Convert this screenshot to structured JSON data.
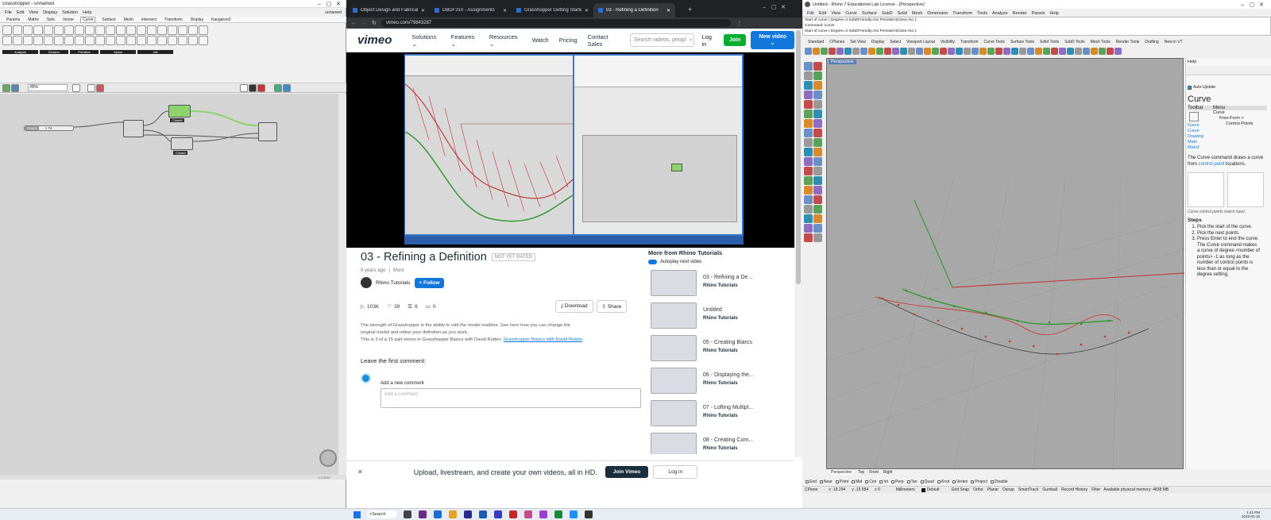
{
  "grasshopper": {
    "title": "Grasshopper - unnamed",
    "doc_name": "unnamed",
    "menu": [
      "File",
      "Edit",
      "View",
      "Display",
      "Solution",
      "Help"
    ],
    "tabs": [
      "Params",
      "Maths",
      "Sets",
      "Vector",
      "Curve",
      "Surface",
      "Mesh",
      "Intersect",
      "Transform",
      "Display",
      "Kangaroo2"
    ],
    "active_tab": "Curve",
    "groups": [
      "Analysis",
      "Division",
      "Primitive",
      "Spline",
      "Util"
    ],
    "zoom": "85%",
    "slider_label": "Count",
    "slider_value": "◊ 74",
    "node_labels": [
      "Closed",
      "Closed"
    ],
    "version": "1.0.0007"
  },
  "browser": {
    "tabs": [
      "Object Design and Fabrication",
      "DBDF310 - Assignments",
      "Grasshopper Getting Started by",
      "03 - Refining a Definition"
    ],
    "active_tab_index": 3,
    "url": "vimeo.com/79843287",
    "nav": {
      "logo": "vimeo",
      "items": [
        "Solutions ⌄",
        "Features ⌄",
        "Resources ⌄",
        "Watch",
        "Pricing",
        "Contact Sales"
      ],
      "search_placeholder": "Search videos, peopl",
      "login": "Log in",
      "join": "Join",
      "new_video": "New video ⌄"
    },
    "video": {
      "title": "03 - Refining a Definition",
      "rating": "NOT YET RATED",
      "posted": "9 years ago",
      "more": "More",
      "channel": "Rhino Tutorials",
      "follow": "+ Follow",
      "stats": {
        "plays": "103K",
        "likes": "39",
        "collections": "6",
        "comments": "0"
      },
      "download": "Download",
      "share": "Share",
      "description": [
        "The strength of Grasshopper is the ability to edit the model realtime. See here how you can change the",
        "original model and refine your definition as you work.",
        "This is 3 of a 15 part series in Grasshopper Basics with David Rutten."
      ],
      "desc_link": "Grasshopper Basics with David Rutten",
      "leave_comment": "Leave the first comment:",
      "add_comment_label": "Add a new comment",
      "comment_placeholder": "Add a comment"
    },
    "sidebar": {
      "heading": "More from Rhino Tutorials",
      "autoplay": "Autoplay next video",
      "items": [
        {
          "title": "03 - Refining a De...",
          "channel": "Rhino Tutorials"
        },
        {
          "title": "Untitled",
          "channel": "Rhino Tutorials"
        },
        {
          "title": "05 - Creating Biarcs",
          "channel": "Rhino Tutorials"
        },
        {
          "title": "06 - Displaying the...",
          "channel": "Rhino Tutorials"
        },
        {
          "title": "07 - Lofting Multipl...",
          "channel": "Rhino Tutorials"
        },
        {
          "title": "08 - Creating Com...",
          "channel": "Rhino Tutorials"
        }
      ]
    },
    "banner": {
      "text": "Upload, livestream, and create your own videos, all in HD.",
      "join": "Join Vimeo",
      "login": "Log in"
    }
  },
  "rhino": {
    "title": "Untitled - Rhino 7 Educational Lab License - [Perspective]",
    "menu": [
      "File",
      "Edit",
      "View",
      "Curve",
      "Surface",
      "SubD",
      "Solid",
      "Mesh",
      "Dimension",
      "Transform",
      "Tools",
      "Analyze",
      "Render",
      "Panels",
      "Help"
    ],
    "cmd_lines": [
      "Start of curve ( Degree=3  SubDFriendly=No  PersistentClose=No ):",
      "Command: Curve",
      "Start of curve ( Degree=3  SubDFriendly=No  PersistentClose=No ):"
    ],
    "toolbar_tabs": [
      "Standard",
      "CPlanes",
      "Set View",
      "Display",
      "Select",
      "Viewport Layout",
      "Visibility",
      "Transform",
      "Curve Tools",
      "Surface Tools",
      "Solid Tools",
      "SubD Tools",
      "Mesh Tools",
      "Render Tools",
      "Drafting",
      "New in V7"
    ],
    "viewport_label": "Perspective",
    "viewport_tabs": [
      "Perspective",
      "Top",
      "Front",
      "Right"
    ],
    "osnaps": [
      "End",
      "Near",
      "Point",
      "Mid",
      "Cen",
      "Int",
      "Perp",
      "Tan",
      "Quad",
      "Knot",
      "Vertex",
      "Project",
      "Disable"
    ],
    "status": {
      "cplane": "CPlane",
      "x": "x -18.294",
      "y": "y -15.584",
      "z": "z 0",
      "units": "Millimeters",
      "layer": "Default",
      "items": [
        "Grid Snap",
        "Ortho",
        "Planar",
        "Osnap",
        "SmartTrack",
        "Gumball",
        "Record History",
        "Filter"
      ],
      "memory": "Available physical memory: 4838 MB"
    },
    "help": {
      "panel_title": "Help",
      "auto_update": "Auto-Update",
      "command": "Curve",
      "toolbar_col": "Toolbar",
      "menu_col": "Menu",
      "toolbar_item": "Curve",
      "menu_item": "Curve",
      "menu_sub": "Free-Form >",
      "menu_sub2": "Control Points",
      "links": [
        "Curve",
        "Curve Drawing",
        "Main",
        "Main2"
      ],
      "desc_parts": [
        "The Curve command draws a curve from",
        "control point",
        "locations."
      ],
      "caption": "Curve control points match input.",
      "steps_title": "Steps",
      "steps": [
        "Pick the start of the curve.",
        "Pick the next points.",
        "Press Enter to end the curve."
      ],
      "step_extra": "The Curve command makes a curve of degree <number of points> -1 as long as the number of control points is less than or equal to the degree setting."
    }
  },
  "taskbar": {
    "search": "Search",
    "time": "1:41 PM",
    "date": "2023-01-16"
  }
}
